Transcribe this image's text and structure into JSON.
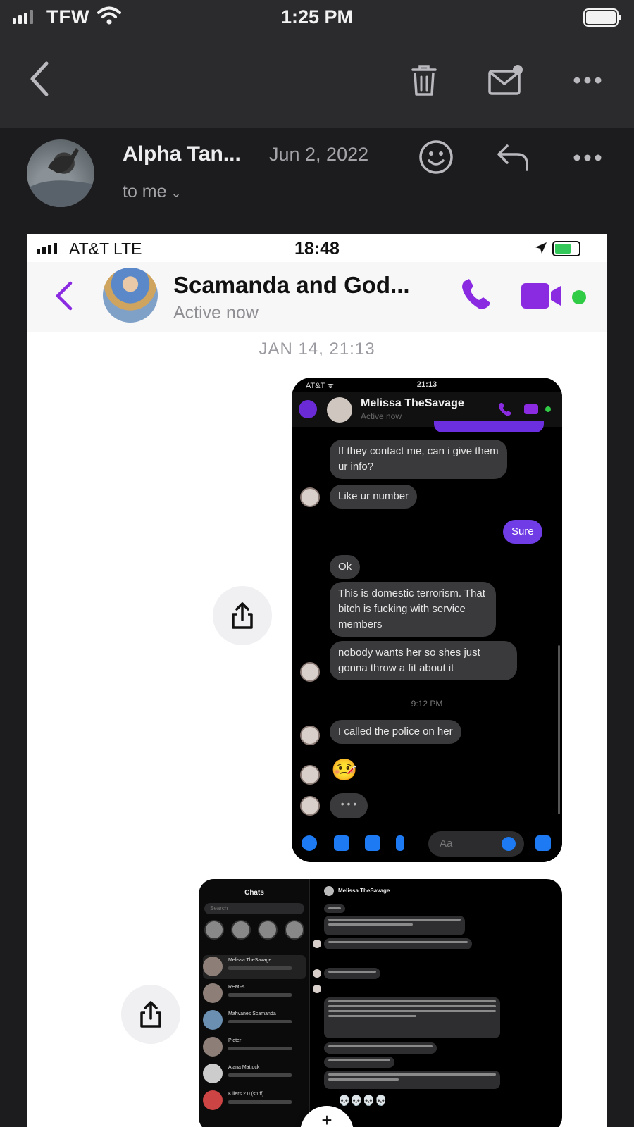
{
  "status_bar": {
    "carrier": "TFW",
    "time": "1:25 PM"
  },
  "toolbar": {
    "back_icon": "chevron-left-icon",
    "trash_icon": "trash-icon",
    "mark_unread_icon": "mail-badge-icon",
    "more_icon": "ellipsis-icon"
  },
  "mail_header": {
    "sender": "Alpha Tan...",
    "date": "Jun 2, 2022",
    "to": "to me",
    "to_chevron": "⌄",
    "emoji_icon": "smiley-icon",
    "reply_icon": "reply-icon",
    "more_icon": "ellipsis-icon"
  },
  "attachment": {
    "status": {
      "carrier": "AT&T  LTE",
      "time": "18:48"
    },
    "chat": {
      "name": "Scamanda and God...",
      "status": "Active now",
      "date_divider": "JAN 14, 21:13"
    },
    "shot1": {
      "status_left": "AT&T ᯤ",
      "status_time": "21:13",
      "contact_name": "Melissa TheSavage",
      "contact_sub": "Active now",
      "messages": [
        "If they contact me, can i give them ur info?",
        "Like ur number",
        "Sure",
        "Ok",
        "This is domestic terrorism. That bitch is fucking with service members",
        "nobody wants her so shes just gonna throw a fit about it",
        "I called the police on her"
      ],
      "time_divider": "9:12 PM",
      "emoji": "🤒",
      "typing": "• • •",
      "input_placeholder": "Aa"
    },
    "shot2": {
      "chats_title": "Chats",
      "search_placeholder": "Search",
      "contact_name": "Melissa TheSavage",
      "list": [
        "Melissa TheSavage",
        "REMFs",
        "Mahvanes Scamanda",
        "Pieter",
        "Alana Mattock",
        "Killers 2.0 (stuff)"
      ],
      "emoji_row": "💀💀💀💀"
    }
  },
  "colors": {
    "dark_bg": "#1c1c1e",
    "toolbar_bg": "#2b2b2e",
    "messenger_purple": "#8a2be2",
    "online_green": "#31cc46"
  }
}
